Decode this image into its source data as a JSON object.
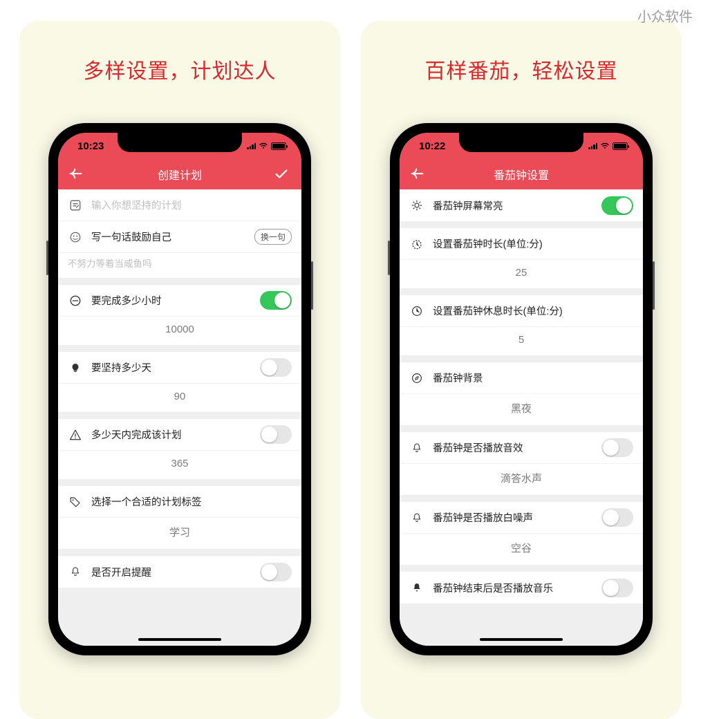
{
  "watermark": "小众软件",
  "left": {
    "tagline": "多样设置，计划达人",
    "status_time": "10:23",
    "nav_title": "创建计划",
    "plan_input_placeholder": "输入你想坚持的计划",
    "motto_label": "写一句话鼓励自己",
    "motto_change_btn": "换一句",
    "motto_placeholder": "不努力等着当咸鱼吗",
    "hours_label": "要完成多少小时",
    "hours_value": "10000",
    "hours_toggle": true,
    "days_persist_label": "要坚持多少天",
    "days_persist_value": "90",
    "days_persist_toggle": false,
    "days_finish_label": "多少天内完成该计划",
    "days_finish_value": "365",
    "days_finish_toggle": false,
    "tag_label": "选择一个合适的计划标签",
    "tag_value": "学习",
    "reminder_label": "是否开启提醒",
    "reminder_toggle": false
  },
  "right": {
    "tagline": "百样番茄，轻松设置",
    "status_time": "10:22",
    "nav_title": "番茄钟设置",
    "keepon_label": "番茄钟屏幕常亮",
    "keepon_toggle": true,
    "duration_label": "设置番茄钟时长(单位:分)",
    "duration_value": "25",
    "rest_label": "设置番茄钟休息时长(单位:分)",
    "rest_value": "5",
    "bg_label": "番茄钟背景",
    "bg_value": "黑夜",
    "sfx_label": "番茄钟是否播放音效",
    "sfx_value": "滴答水声",
    "sfx_toggle": false,
    "noise_label": "番茄钟是否播放白噪声",
    "noise_value": "空谷",
    "noise_toggle": false,
    "music_label": "番茄钟结束后是否播放音乐",
    "music_toggle": false
  }
}
